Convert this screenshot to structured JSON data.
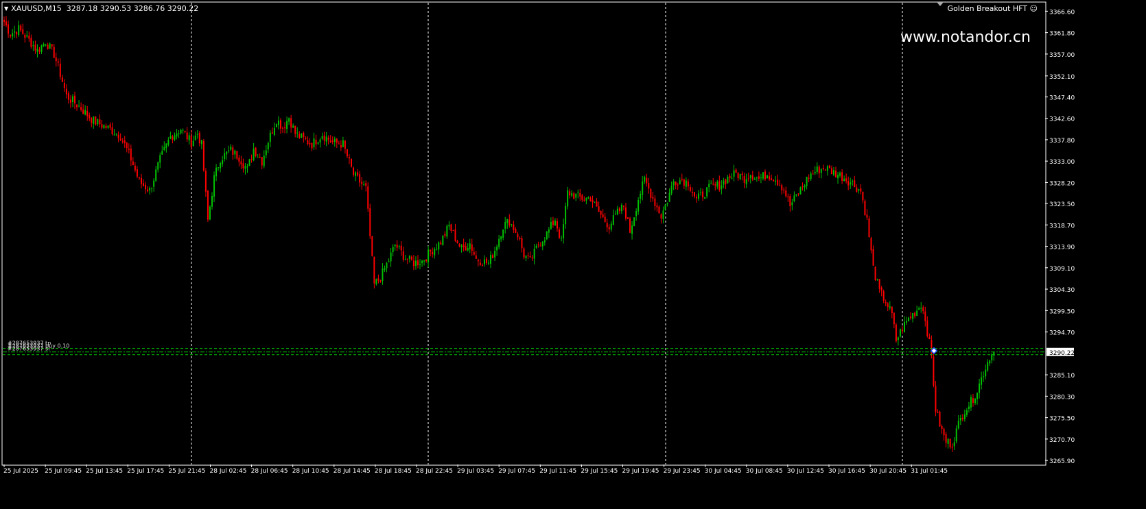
{
  "header": {
    "symbol": "XAUUSD,M15",
    "ohlc": "3287.18 3290.53 3286.76 3290.22"
  },
  "expert_advisor": {
    "name": "Golden Breakout HFT",
    "icon": "smiley-icon"
  },
  "watermark": "www.notandor.cn",
  "trade_labels": [
    "#287653937 tp",
    "#287653937 buy 0.10",
    "#287653937 sl"
  ],
  "colors": {
    "background": "#000000",
    "bull": "#00c000",
    "bear": "#ff0000",
    "grid": "#ffffff",
    "price_line": "#00c000",
    "axis_text": "#ffffff"
  },
  "chart_data": {
    "type": "candlestick",
    "title": "",
    "xlabel": "",
    "ylabel": "",
    "ylim": [
      3265.0,
      3368.5
    ],
    "y_ticks": [
      "3366.60",
      "3361.80",
      "3357.00",
      "3352.10",
      "3347.40",
      "3342.60",
      "3337.80",
      "3333.00",
      "3328.20",
      "3323.50",
      "3318.70",
      "3313.90",
      "3309.10",
      "3304.30",
      "3299.50",
      "3294.70",
      "3285.10",
      "3280.30",
      "3275.50",
      "3270.70",
      "3265.90"
    ],
    "x_ticks": [
      "25 Jul 2025",
      "25 Jul 09:45",
      "25 Jul 13:45",
      "25 Jul 17:45",
      "25 Jul 21:45",
      "28 Jul 02:45",
      "28 Jul 06:45",
      "28 Jul 10:45",
      "28 Jul 14:45",
      "28 Jul 18:45",
      "28 Jul 22:45",
      "29 Jul 03:45",
      "29 Jul 07:45",
      "29 Jul 11:45",
      "29 Jul 15:45",
      "29 Jul 19:45",
      "29 Jul 23:45",
      "30 Jul 04:45",
      "30 Jul 08:45",
      "30 Jul 12:45",
      "30 Jul 16:45",
      "30 Jul 20:45",
      "31 Jul 01:45"
    ],
    "current_price": "3290.22",
    "price_levels": [
      3291.0,
      3290.22,
      3289.6
    ],
    "period_separators": [
      "25 Jul 21:45",
      "28 Jul 22:45",
      "29 Jul 23:45",
      "30 Jul 20:45"
    ],
    "grid": false,
    "bars": 448,
    "close_path": [
      [
        0,
        3364.2
      ],
      [
        3,
        3361.5
      ],
      [
        7,
        3362.6
      ],
      [
        12,
        3360.1
      ],
      [
        16,
        3357.8
      ],
      [
        20,
        3359.8
      ],
      [
        24,
        3357.0
      ],
      [
        27,
        3352.6
      ],
      [
        30,
        3347.6
      ],
      [
        36,
        3345.3
      ],
      [
        43,
        3342.0
      ],
      [
        50,
        3340.4
      ],
      [
        56,
        3338.7
      ],
      [
        61,
        3333.5
      ],
      [
        65,
        3328.4
      ],
      [
        70,
        3326.4
      ],
      [
        75,
        3333.3
      ],
      [
        80,
        3338.5
      ],
      [
        85,
        3340.2
      ],
      [
        90,
        3337.2
      ],
      [
        93,
        3339.2
      ],
      [
        95,
        3336.6
      ],
      [
        98,
        3319.7
      ],
      [
        101,
        3329.2
      ],
      [
        104,
        3333.6
      ],
      [
        109,
        3335.4
      ],
      [
        113,
        3333.9
      ],
      [
        117,
        3331.1
      ],
      [
        120,
        3335.8
      ],
      [
        124,
        3333.0
      ],
      [
        127,
        3337.5
      ],
      [
        131,
        3342.4
      ],
      [
        134,
        3340.6
      ],
      [
        137,
        3342.8
      ],
      [
        140,
        3339.2
      ],
      [
        143,
        3338.2
      ],
      [
        148,
        3336.8
      ],
      [
        153,
        3339.0
      ],
      [
        158,
        3337.2
      ],
      [
        163,
        3336.8
      ],
      [
        168,
        3330.0
      ],
      [
        174,
        3326.8
      ],
      [
        178,
        3305.3
      ],
      [
        181,
        3306.9
      ],
      [
        185,
        3310.8
      ],
      [
        188,
        3314.3
      ],
      [
        193,
        3311.3
      ],
      [
        197,
        3310.2
      ],
      [
        201,
        3310.6
      ],
      [
        205,
        3312.7
      ],
      [
        210,
        3314.9
      ],
      [
        214,
        3318.5
      ],
      [
        217,
        3315.8
      ],
      [
        220,
        3313.2
      ],
      [
        224,
        3314.6
      ],
      [
        227,
        3311.1
      ],
      [
        230,
        3310.6
      ],
      [
        233,
        3310.1
      ],
      [
        236,
        3313.1
      ],
      [
        240,
        3318.5
      ],
      [
        243,
        3319.6
      ],
      [
        247,
        3316.5
      ],
      [
        250,
        3312.0
      ],
      [
        253,
        3310.5
      ],
      [
        257,
        3314.3
      ],
      [
        261,
        3316.7
      ],
      [
        265,
        3320.0
      ],
      [
        268,
        3314.9
      ],
      [
        271,
        3326.0
      ],
      [
        275,
        3325.2
      ],
      [
        279,
        3324.5
      ],
      [
        282,
        3324.9
      ],
      [
        285,
        3322.3
      ],
      [
        288,
        3320.2
      ],
      [
        291,
        3318.5
      ],
      [
        295,
        3321.4
      ],
      [
        298,
        3322.9
      ],
      [
        301,
        3317.3
      ],
      [
        305,
        3324.6
      ],
      [
        308,
        3328.8
      ],
      [
        312,
        3324.7
      ],
      [
        316,
        3320.7
      ],
      [
        319,
        3324.3
      ],
      [
        322,
        3328.5
      ],
      [
        326,
        3328.8
      ],
      [
        329,
        3328.2
      ],
      [
        333,
        3324.3
      ],
      [
        337,
        3326.0
      ],
      [
        340,
        3327.2
      ],
      [
        344,
        3327.6
      ],
      [
        348,
        3329.2
      ],
      [
        352,
        3330.2
      ],
      [
        356,
        3329.2
      ],
      [
        359,
        3330.2
      ],
      [
        363,
        3329.0
      ],
      [
        367,
        3330.1
      ],
      [
        371,
        3329.0
      ],
      [
        375,
        3326.8
      ],
      [
        378,
        3323.0
      ],
      [
        383,
        3326.6
      ],
      [
        387,
        3329.6
      ],
      [
        391,
        3331.0
      ],
      [
        395,
        3331.5
      ],
      [
        399,
        3330.5
      ],
      [
        404,
        3329.3
      ],
      [
        408,
        3328.0
      ],
      [
        412,
        3326.3
      ],
      [
        415,
        3319.7
      ],
      [
        418,
        3309.0
      ],
      [
        421,
        3303.7
      ],
      [
        424,
        3301.6
      ],
      [
        427,
        3298.5
      ],
      [
        429,
        3292.8
      ],
      [
        432,
        3295.6
      ],
      [
        435,
        3297.7
      ],
      [
        439,
        3299.6
      ],
      [
        441,
        3301.0
      ],
      [
        443,
        3297.7
      ],
      [
        446,
        3289.2
      ],
      [
        448,
        3277.3
      ],
      [
        451,
        3272.5
      ],
      [
        453,
        3270.1
      ],
      [
        456,
        3269.6
      ],
      [
        459,
        3274.0
      ],
      [
        462,
        3277.3
      ],
      [
        465,
        3279.0
      ],
      [
        468,
        3281.7
      ],
      [
        471,
        3285.6
      ],
      [
        474,
        3289.2
      ],
      [
        476,
        3290.22
      ]
    ]
  }
}
